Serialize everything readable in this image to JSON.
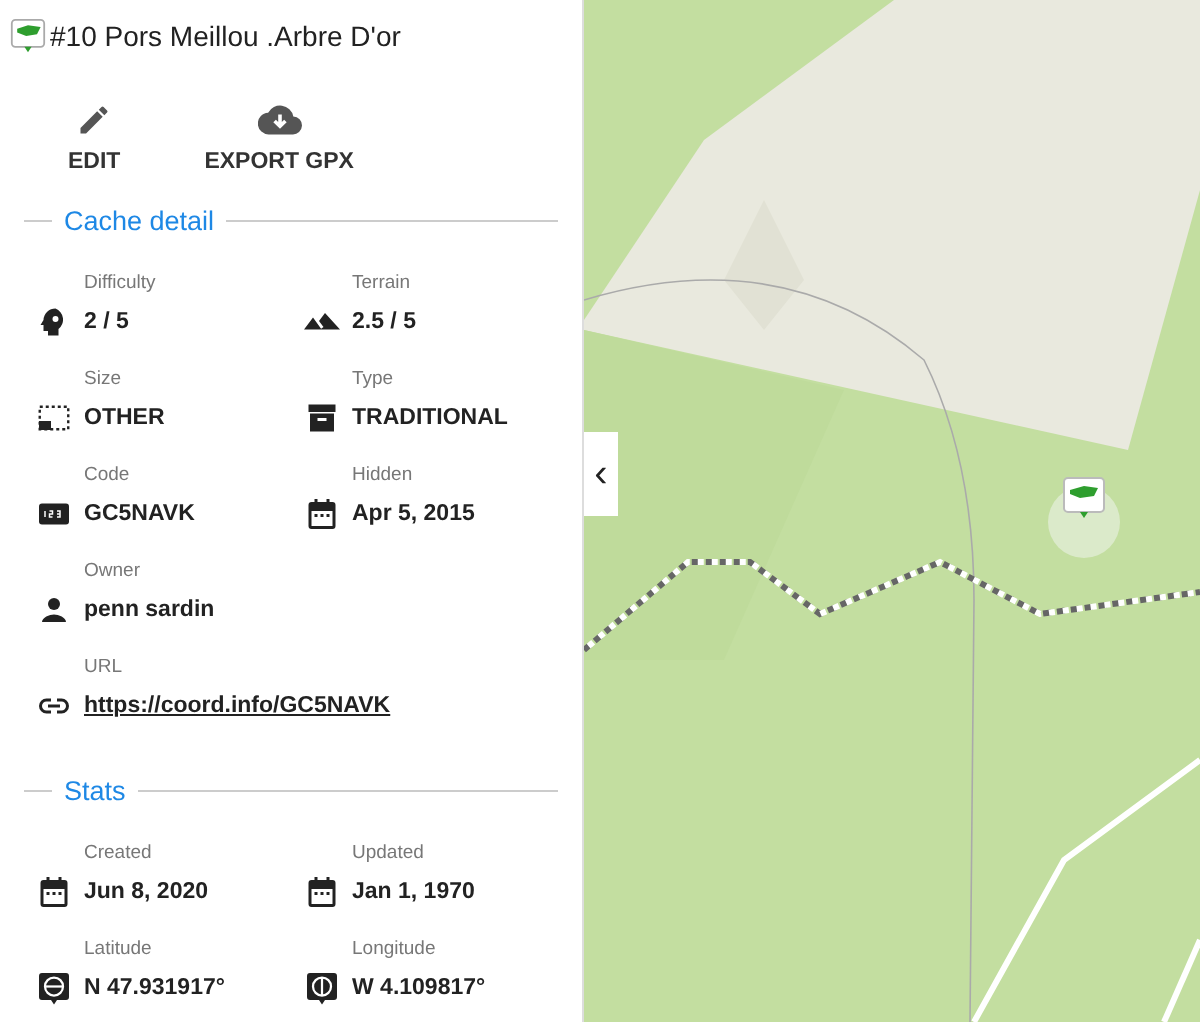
{
  "header": {
    "title": "#10 Pors Meillou .Arbre D'or"
  },
  "actions": [
    {
      "kind": "edit",
      "label": "EDIT"
    },
    {
      "kind": "export",
      "label": "EXPORT GPX"
    }
  ],
  "sections": [
    {
      "title": "Cache detail",
      "rows": [
        [
          {
            "label": "Difficulty",
            "value": "2 / 5",
            "kind": "difficulty"
          },
          {
            "label": "Terrain",
            "value": "2.5 / 5",
            "kind": "terrain"
          }
        ],
        [
          {
            "label": "Size",
            "value": "OTHER",
            "kind": "size"
          },
          {
            "label": "Type",
            "value": "TRADITIONAL",
            "kind": "type"
          }
        ],
        [
          {
            "label": "Code",
            "value": "GC5NAVK",
            "kind": "code"
          },
          {
            "label": "Hidden",
            "value": "Apr 5, 2015",
            "kind": "date"
          }
        ],
        [
          {
            "label": "Owner",
            "value": "penn sardin",
            "kind": "person"
          }
        ],
        [
          {
            "label": "URL",
            "value": "https://coord.info/GC5NAVK",
            "kind": "url"
          }
        ]
      ]
    },
    {
      "title": "Stats",
      "rows": [
        [
          {
            "label": "Created",
            "value": "Jun 8, 2020",
            "kind": "date"
          },
          {
            "label": "Updated",
            "value": "Jan 1, 1970",
            "kind": "date"
          }
        ],
        [
          {
            "label": "Latitude",
            "value": "N 47.931917°",
            "kind": "latitude"
          },
          {
            "label": "Longitude",
            "value": "W 4.109817°",
            "kind": "longitude"
          }
        ]
      ]
    }
  ],
  "map": {
    "kind": "picture",
    "collapse_button": "‹"
  }
}
